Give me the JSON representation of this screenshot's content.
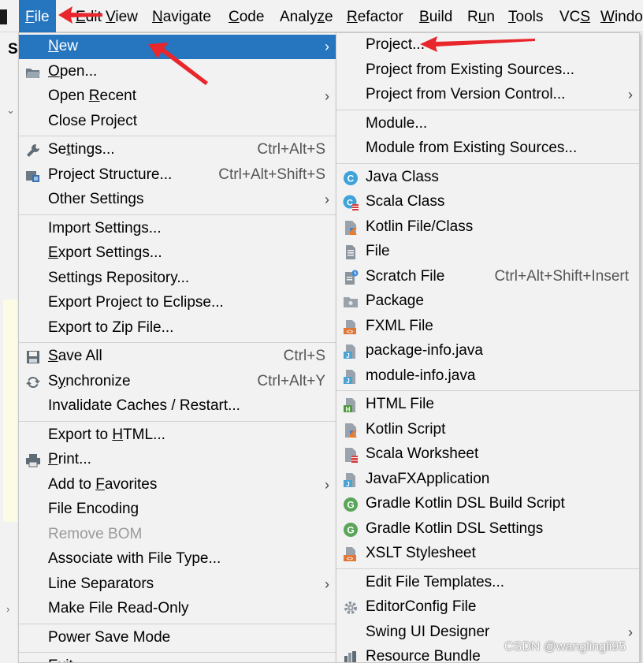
{
  "menubar": {
    "items": [
      {
        "label": "File",
        "mnemonic": "F"
      },
      {
        "label": "Edit",
        "mnemonic": "E"
      },
      {
        "label": "View",
        "mnemonic": "V"
      },
      {
        "label": "Navigate",
        "mnemonic": "N"
      },
      {
        "label": "Code",
        "mnemonic": "C"
      },
      {
        "label": "Analyze",
        "mnemonic": "z"
      },
      {
        "label": "Refactor",
        "mnemonic": "R"
      },
      {
        "label": "Build",
        "mnemonic": "B"
      },
      {
        "label": "Run",
        "mnemonic": "u"
      },
      {
        "label": "Tools",
        "mnemonic": "T"
      },
      {
        "label": "VCS",
        "mnemonic": "S"
      },
      {
        "label": "Window",
        "mnemonic": "W"
      }
    ]
  },
  "background": {
    "left_letter": "S",
    "tick_top": "⌄",
    "tick_bottom": "›"
  },
  "file_menu": {
    "items": [
      {
        "label": "New",
        "mnemonic": "N",
        "submenu": true,
        "selected": true
      },
      {
        "label": "Open...",
        "mnemonic": "O",
        "icon": "folder-icon"
      },
      {
        "label": "Open Recent",
        "mnemonic": "R",
        "submenu": true
      },
      {
        "label": "Close Project"
      },
      {
        "separator": true
      },
      {
        "label": "Settings...",
        "mnemonic": "t",
        "shortcut": "Ctrl+Alt+S",
        "icon": "wrench-icon"
      },
      {
        "label": "Project Structure...",
        "shortcut": "Ctrl+Alt+Shift+S",
        "icon": "project-structure-icon"
      },
      {
        "label": "Other Settings",
        "submenu": true
      },
      {
        "separator": true
      },
      {
        "label": "Import Settings..."
      },
      {
        "label": "Export Settings...",
        "mnemonic": "E"
      },
      {
        "label": "Settings Repository..."
      },
      {
        "label": "Export Project to Eclipse..."
      },
      {
        "label": "Export to Zip File..."
      },
      {
        "separator": true
      },
      {
        "label": "Save All",
        "mnemonic": "S",
        "shortcut": "Ctrl+S",
        "icon": "save-icon"
      },
      {
        "label": "Synchronize",
        "mnemonic": "y",
        "shortcut": "Ctrl+Alt+Y",
        "icon": "sync-icon"
      },
      {
        "label": "Invalidate Caches / Restart..."
      },
      {
        "separator": true
      },
      {
        "label": "Export to HTML...",
        "mnemonic": "H"
      },
      {
        "label": "Print...",
        "mnemonic": "P",
        "icon": "printer-icon"
      },
      {
        "label": "Add to Favorites",
        "mnemonic": "F",
        "submenu": true
      },
      {
        "label": "File Encoding"
      },
      {
        "label": "Remove BOM",
        "disabled": true
      },
      {
        "label": "Associate with File Type..."
      },
      {
        "label": "Line Separators",
        "submenu": true
      },
      {
        "label": "Make File Read-Only"
      },
      {
        "separator": true
      },
      {
        "label": "Power Save Mode"
      },
      {
        "separator": true
      },
      {
        "label": "Exit",
        "mnemonic": "x"
      }
    ]
  },
  "new_submenu": {
    "items": [
      {
        "label": "Project..."
      },
      {
        "label": "Project from Existing Sources..."
      },
      {
        "label": "Project from Version Control...",
        "submenu": true
      },
      {
        "separator": true
      },
      {
        "label": "Module..."
      },
      {
        "label": "Module from Existing Sources..."
      },
      {
        "separator": true
      },
      {
        "label": "Java Class",
        "icon": "java-class-icon"
      },
      {
        "label": "Scala Class",
        "icon": "scala-class-icon"
      },
      {
        "label": "Kotlin File/Class",
        "icon": "kotlin-file-icon"
      },
      {
        "label": "File",
        "icon": "file-icon"
      },
      {
        "label": "Scratch File",
        "shortcut": "Ctrl+Alt+Shift+Insert",
        "icon": "scratch-file-icon"
      },
      {
        "label": "Package",
        "icon": "package-icon"
      },
      {
        "label": "FXML File",
        "icon": "fxml-file-icon"
      },
      {
        "label": "package-info.java",
        "icon": "java-file-icon"
      },
      {
        "label": "module-info.java",
        "icon": "java-file-icon"
      },
      {
        "separator": true
      },
      {
        "label": "HTML File",
        "icon": "html-file-icon"
      },
      {
        "label": "Kotlin Script",
        "icon": "kotlin-script-icon"
      },
      {
        "label": "Scala Worksheet",
        "icon": "scala-worksheet-icon"
      },
      {
        "label": "JavaFXApplication",
        "icon": "java-file-icon"
      },
      {
        "label": "Gradle Kotlin DSL Build Script",
        "icon": "gradle-icon"
      },
      {
        "label": "Gradle Kotlin DSL Settings",
        "icon": "gradle-icon"
      },
      {
        "label": "XSLT Stylesheet",
        "icon": "xslt-icon"
      },
      {
        "separator": true
      },
      {
        "label": "Edit File Templates..."
      },
      {
        "label": "EditorConfig File",
        "icon": "gear-icon"
      },
      {
        "label": "Swing UI Designer",
        "submenu": true
      },
      {
        "label": "Resource Bundle",
        "icon": "resource-bundle-icon"
      }
    ]
  },
  "watermark": "CSDN @wanglingli95",
  "colors": {
    "selection": "#2675bf",
    "menu_bg": "#f2f2f2",
    "annotation_arrow": "#e8262b",
    "disabled_text": "#9a9a9a"
  }
}
